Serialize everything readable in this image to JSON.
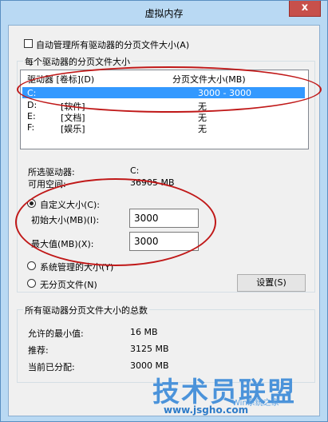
{
  "window": {
    "title": "虚拟内存",
    "close_label": "x"
  },
  "auto_manage": {
    "label": "自动管理所有驱动器的分页文件大小(A)",
    "checked": false
  },
  "drives_group": {
    "label": "每个驱动器的分页文件大小",
    "col_drive": "驱动器 [卷标](D)",
    "col_size": "分页文件大小(MB)",
    "rows": [
      {
        "drive": "C:",
        "label": "",
        "size": "3000 - 3000",
        "selected": true
      },
      {
        "drive": "D:",
        "label": "[软件]",
        "size": "无",
        "selected": false
      },
      {
        "drive": "E:",
        "label": "[文档]",
        "size": "无",
        "selected": false
      },
      {
        "drive": "F:",
        "label": "[娱乐]",
        "size": "无",
        "selected": false
      }
    ],
    "selected_drive_label": "所选驱动器:",
    "selected_drive_value": "C:",
    "free_space_label": "可用空间:",
    "free_space_value": "36905 MB"
  },
  "custom_size": {
    "label": "自定义大小(C):",
    "initial_label": "初始大小(MB)(I):",
    "initial_value": "3000",
    "max_label": "最大值(MB)(X):",
    "max_value": "3000"
  },
  "system_managed": {
    "label": "系统管理的大小(Y)"
  },
  "no_paging": {
    "label": "无分页文件(N)"
  },
  "set_button": {
    "label": "设置(S)"
  },
  "totals_group": {
    "label": "所有驱动器分页文件大小的总数",
    "min_label": "允许的最小值:",
    "min_value": "16 MB",
    "recommended_label": "推荐:",
    "recommended_value": "3125 MB",
    "current_label": "当前已分配:",
    "current_value": "3000 MB"
  },
  "watermark": {
    "text": "技术员联盟",
    "url": "www.jsgho.com",
    "sub": "Win系统之家"
  }
}
